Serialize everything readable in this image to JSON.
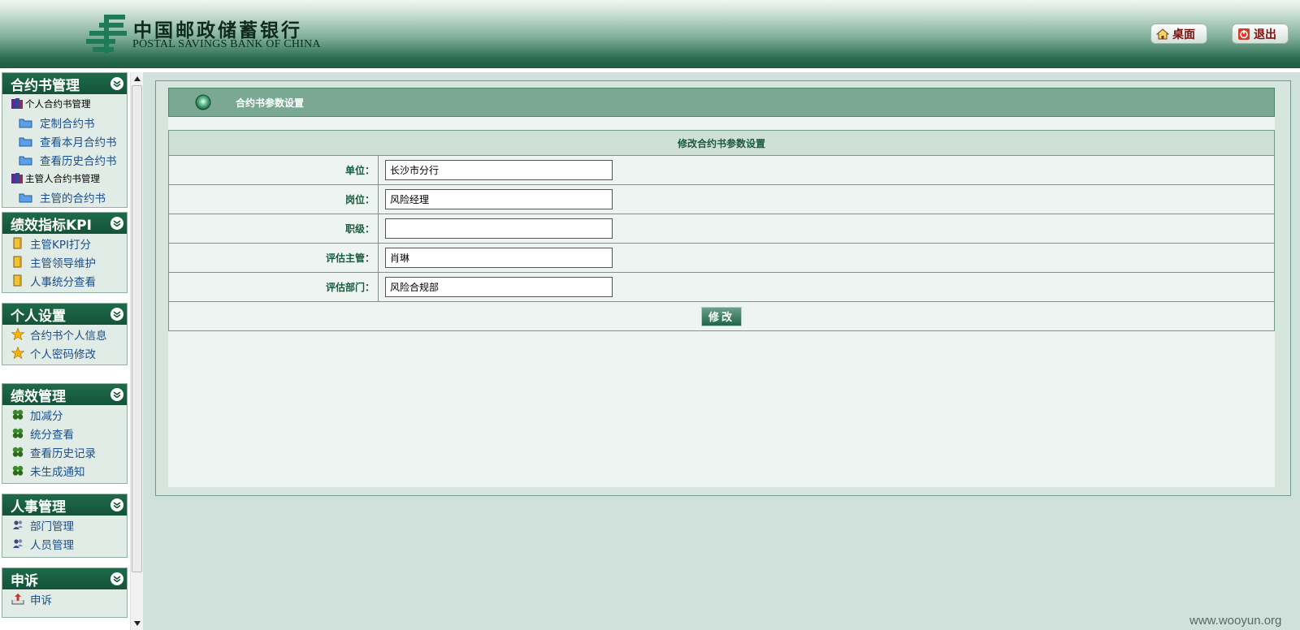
{
  "header": {
    "brand_cn": "中国邮政储蓄银行",
    "brand_en": "POSTAL SAVINGS BANK OF CHINA",
    "desktop_label": "桌面",
    "logout_label": "退出"
  },
  "sidebar": {
    "contract": {
      "title": "合约书管理",
      "groups": [
        {
          "label": "个人合约书管理",
          "items": [
            "定制合约书",
            "查看本月合约书",
            "查看历史合约书"
          ]
        },
        {
          "label": "主管人合约书管理",
          "items": [
            "主管的合约书"
          ]
        }
      ]
    },
    "kpi": {
      "title": "绩效指标KPI",
      "items": [
        "主管KPI打分",
        "主管领导维护",
        "人事统分查看"
      ]
    },
    "personal": {
      "title": "个人设置",
      "items": [
        "合约书个人信息",
        "个人密码修改"
      ]
    },
    "performance": {
      "title": "绩效管理",
      "items": [
        "加减分",
        "统分查看",
        "查看历史记录",
        "未生成通知"
      ]
    },
    "hr": {
      "title": "人事管理",
      "items": [
        "部门管理",
        "人员管理"
      ]
    },
    "appeal": {
      "title": "申诉",
      "items": [
        "申诉"
      ]
    }
  },
  "main": {
    "page_title": "合约书参数设置",
    "form_title": "修改合约书参数设置",
    "fields": [
      {
        "label": "单位：",
        "value": "长沙市分行"
      },
      {
        "label": "岗位：",
        "value": "风险经理"
      },
      {
        "label": "职级：",
        "value": ""
      },
      {
        "label": "评估主管：",
        "value": "肖琳"
      },
      {
        "label": "评估部门：",
        "value": "风险合规部"
      }
    ],
    "submit_label": "修改"
  },
  "watermark": "www.wooyun.org",
  "colors": {
    "accent": "#1f6a4a",
    "link": "#1b4f8a",
    "header_btn_text": "#7a1010"
  }
}
